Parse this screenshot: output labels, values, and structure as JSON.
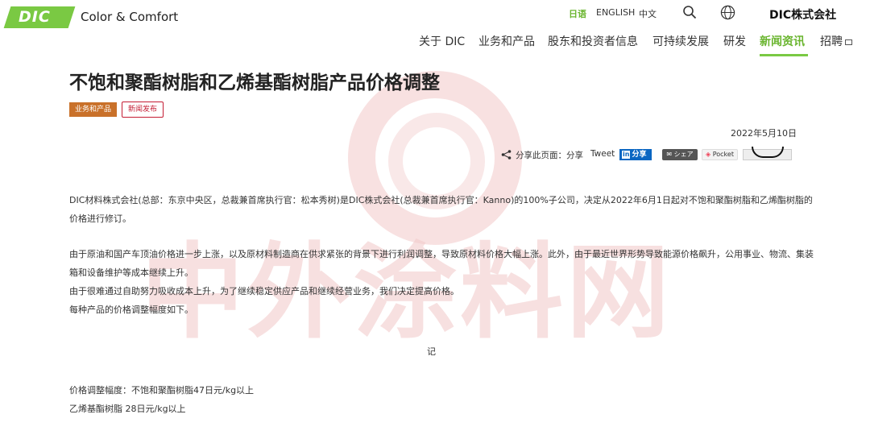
{
  "header": {
    "logo_text": "DIC",
    "brand": "Color & Comfort",
    "languages": [
      {
        "label": "日语",
        "active": true
      },
      {
        "label": "ENGLISH",
        "active": false
      },
      {
        "label": "中文",
        "active": false
      }
    ],
    "corporate_name": "DIC株式会社",
    "icons": {
      "search": "search-icon",
      "globe": "globe-icon",
      "external": "external-link-icon"
    },
    "accent_color": "#6ab52f"
  },
  "nav": {
    "items": [
      "关于 DIC",
      "业务和产品",
      "股东和投资者信息",
      "可持续发展",
      "研发",
      "新闻资讯",
      "招聘"
    ],
    "active": "新闻资讯"
  },
  "article": {
    "title": "不饱和聚酯树脂和乙烯基酯树脂产品价格调整",
    "tags": [
      "业务和产品",
      "新闻发布"
    ],
    "date": "2022年5月10日",
    "share": {
      "label": "分享此页面：",
      "share_text": "分享",
      "tweet": "Tweet",
      "linkedin": "分享",
      "hatena": "シェア",
      "pocket": "Pocket"
    },
    "paragraphs": [
      "DIC材料株式会社(总部：东京中央区，总裁兼首席执行官：松本秀树)是DIC株式会社(总裁兼首席执行官：Kanno)的100%子公司，决定从2022年6月1日起对不饱和聚酯树脂和乙烯酯树脂的",
      "价格进行修订。",
      "由于原油和国产车顶油价格进一步上涨，以及原材料制造商在供求紧张的背景下进行利润调整，导致原材料价格大幅上涨。此外，由于最近世界形势导致能源价格飙升，公用事业、物流、集装",
      "箱和设备维护等成本继续上升。",
      "由于很难通过自助努力吸收成本上升，为了继续稳定供应产品和继续经营业务，我们决定提高价格。",
      "每种产品的价格调整幅度如下。"
    ],
    "center_mark": "记",
    "price_lines": [
      "价格调整幅度：不饱和聚酯树脂47日元/kg以上",
      "乙烯基酯树脂 28日元/kg以上"
    ]
  },
  "watermark": "中外涂料网"
}
